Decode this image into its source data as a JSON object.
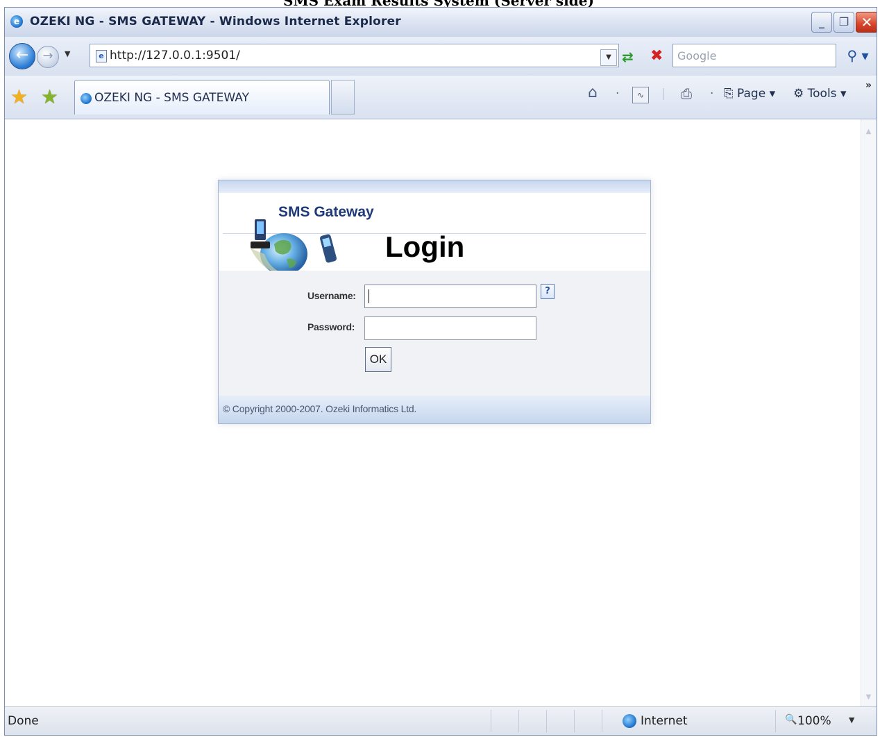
{
  "caption": "SMS Exam Results System (Server side)",
  "window": {
    "title": "OZEKI NG - SMS GATEWAY - Windows Internet Explorer",
    "controls": {
      "minimize": "_",
      "maximize": "❐",
      "close": "✕"
    }
  },
  "address_bar": {
    "url": "http://127.0.0.1:9501/",
    "search_placeholder": "Google"
  },
  "tabs": [
    {
      "label": "OZEKI NG - SMS GATEWAY",
      "active": true
    }
  ],
  "toolbar": {
    "page_label": "Page",
    "tools_label": "Tools"
  },
  "login": {
    "logo_text": "SMS Gateway",
    "title": "Login",
    "username_label": "Username:",
    "password_label": "Password:",
    "username_value": "",
    "password_value": "",
    "help_label": "?",
    "ok_label": "OK",
    "copyright": "© Copyright 2000-2007. Ozeki Informatics Ltd."
  },
  "status_bar": {
    "status": "Done",
    "zone": "Internet",
    "zoom": "100%"
  },
  "icons": [
    "ie-icon",
    "back-icon",
    "forward-icon",
    "page-icon",
    "refresh-icon",
    "stop-icon",
    "search-icon",
    "favorites-star-icon",
    "add-favorites-icon",
    "home-icon",
    "feeds-icon",
    "print-icon",
    "page-menu-icon",
    "tools-menu-icon",
    "globe-icon",
    "zoom-icon",
    "help-icon"
  ],
  "colors": {
    "titlebar": "#dfe6f3",
    "close_button": "#d8452a",
    "panel_border": "#a7b6cf",
    "logo_text": "#1f3a78"
  }
}
